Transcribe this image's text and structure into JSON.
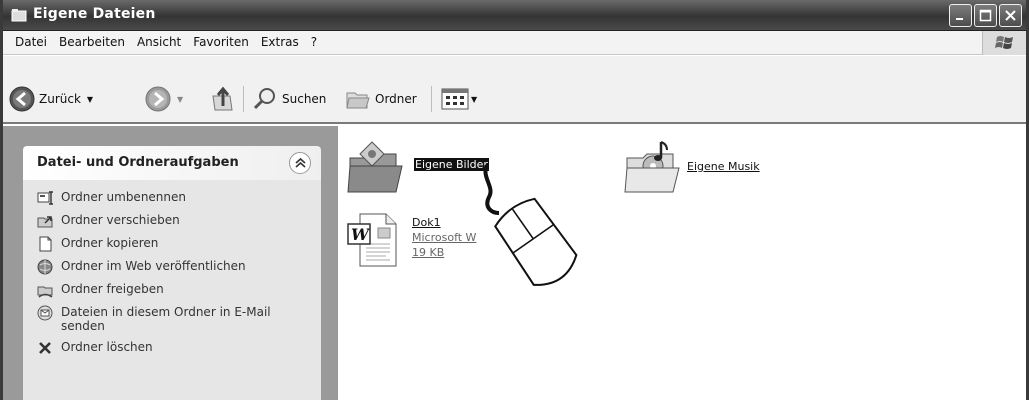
{
  "window": {
    "title": "Eigene Dateien"
  },
  "menu": {
    "items": [
      "Datei",
      "Bearbeiten",
      "Ansicht",
      "Favoriten",
      "Extras",
      "?"
    ]
  },
  "toolbar": {
    "back_label": "Zurück",
    "search_label": "Suchen",
    "folders_label": "Ordner"
  },
  "taskpane": {
    "title": "Datei- und Ordneraufgaben",
    "items": [
      {
        "label": "Ordner umbenennen",
        "icon": "rename-icon"
      },
      {
        "label": "Ordner verschieben",
        "icon": "move-icon"
      },
      {
        "label": "Ordner kopieren",
        "icon": "copy-icon"
      },
      {
        "label": "Ordner im Web veröffentlichen",
        "icon": "web-publish-icon"
      },
      {
        "label": "Ordner freigeben",
        "icon": "share-icon"
      },
      {
        "label": "Dateien in diesem Ordner in E-Mail senden",
        "icon": "email-icon"
      },
      {
        "label": "Ordner löschen",
        "icon": "delete-icon"
      }
    ]
  },
  "files": {
    "pictures": {
      "name": "Eigene Bilder"
    },
    "music": {
      "name": "Eigene Musik"
    },
    "doc": {
      "name": "Dok1",
      "type": "Microsoft W",
      "size": "19 KB"
    }
  }
}
